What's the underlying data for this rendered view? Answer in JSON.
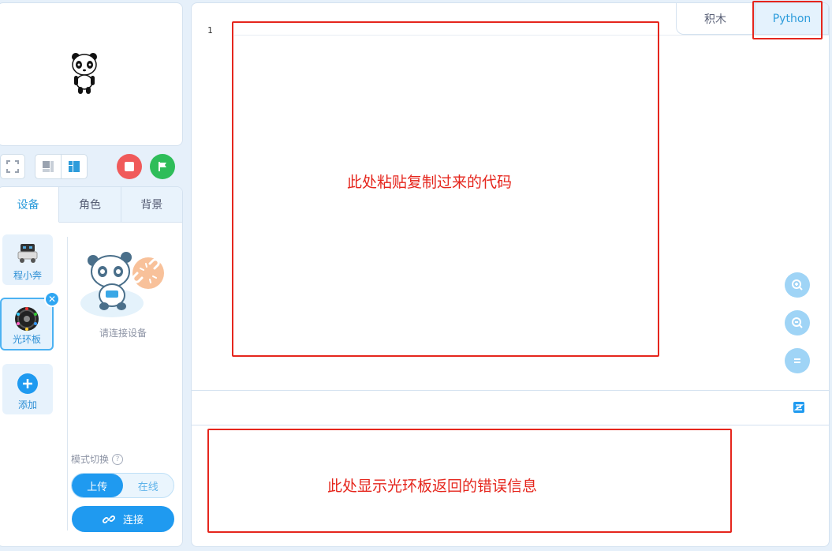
{
  "stage": {
    "sprite_icon": "panda-sprite-icon"
  },
  "controls": {
    "fullscreen_icon": "fullscreen-icon",
    "small_stage_icon": "small-stage-layout-icon",
    "large_stage_icon": "large-stage-layout-icon",
    "stop_color": "#f05a5a",
    "go_color": "#2ebd59"
  },
  "tabs": [
    {
      "label": "设备",
      "active": true
    },
    {
      "label": "角色",
      "active": false
    },
    {
      "label": "背景",
      "active": false
    }
  ],
  "devices": [
    {
      "label": "程小奔",
      "icon": "robot-car-icon",
      "selected": false
    },
    {
      "label": "光环板",
      "icon": "halocode-board-icon",
      "selected": true
    },
    {
      "label": "添加",
      "icon": "plus-icon",
      "selected": false
    }
  ],
  "connect_panel": {
    "hint": "请连接设备",
    "mode_label": "模式切换",
    "mode_options": [
      "上传",
      "在线"
    ],
    "connect_label": "连接"
  },
  "editor": {
    "line_number": "1",
    "tab_blocks": "积木",
    "tab_python": "Python"
  },
  "annotations": {
    "code_hint": "此处粘贴复制过来的代码",
    "error_hint": "此处显示光环板返回的错误信息"
  }
}
